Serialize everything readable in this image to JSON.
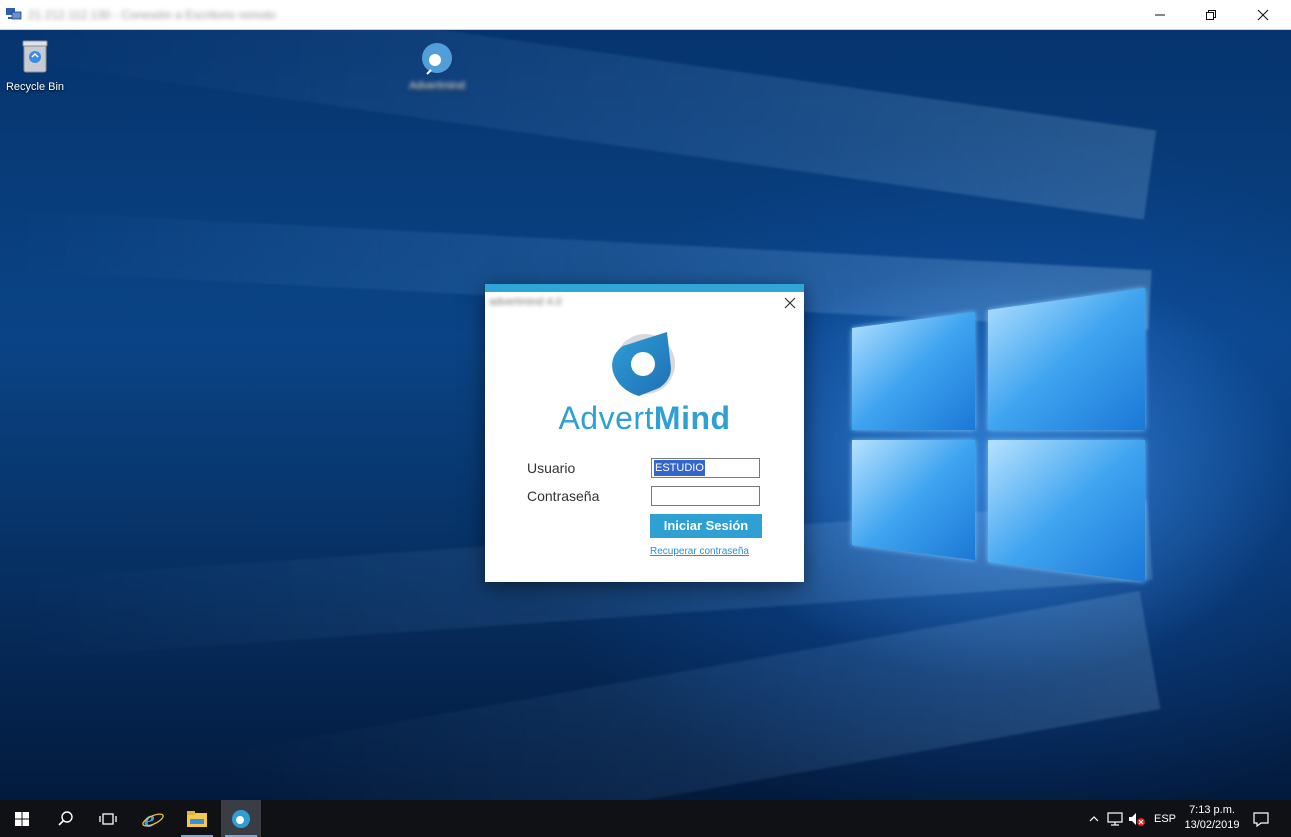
{
  "window": {
    "title": "21.212.112.130 - Conexión a Escritorio remoto",
    "minimize_icon": "minimize-icon",
    "restore_icon": "restore-icon",
    "close_icon": "close-icon"
  },
  "desktop": {
    "icons": [
      {
        "label": "Recycle Bin",
        "icon": "recycle-bin-icon"
      },
      {
        "label": "Advertmind",
        "icon": "advertmind-shortcut-icon"
      }
    ]
  },
  "login_dialog": {
    "title": "advertmind 4.0",
    "brand_light": "Advert",
    "brand_bold": "Mind",
    "user_label": "Usuario",
    "user_value": "ESTUDIO",
    "password_label": "Contraseña",
    "password_value": "",
    "login_button": "Iniciar Sesión",
    "recover_link": "Recuperar contraseña",
    "accent_color": "#2fa0d4"
  },
  "taskbar": {
    "items": [
      {
        "name": "start",
        "icon": "windows-start-icon"
      },
      {
        "name": "search",
        "icon": "search-icon"
      },
      {
        "name": "task-view",
        "icon": "task-view-icon"
      },
      {
        "name": "internet-explorer",
        "icon": "internet-explorer-icon"
      },
      {
        "name": "file-explorer",
        "icon": "file-explorer-icon"
      },
      {
        "name": "advertmind",
        "icon": "advertmind-app-icon",
        "active": true
      }
    ],
    "tray": {
      "language": "ESP",
      "time": "7:13 p.m.",
      "date": "13/02/2019"
    }
  }
}
